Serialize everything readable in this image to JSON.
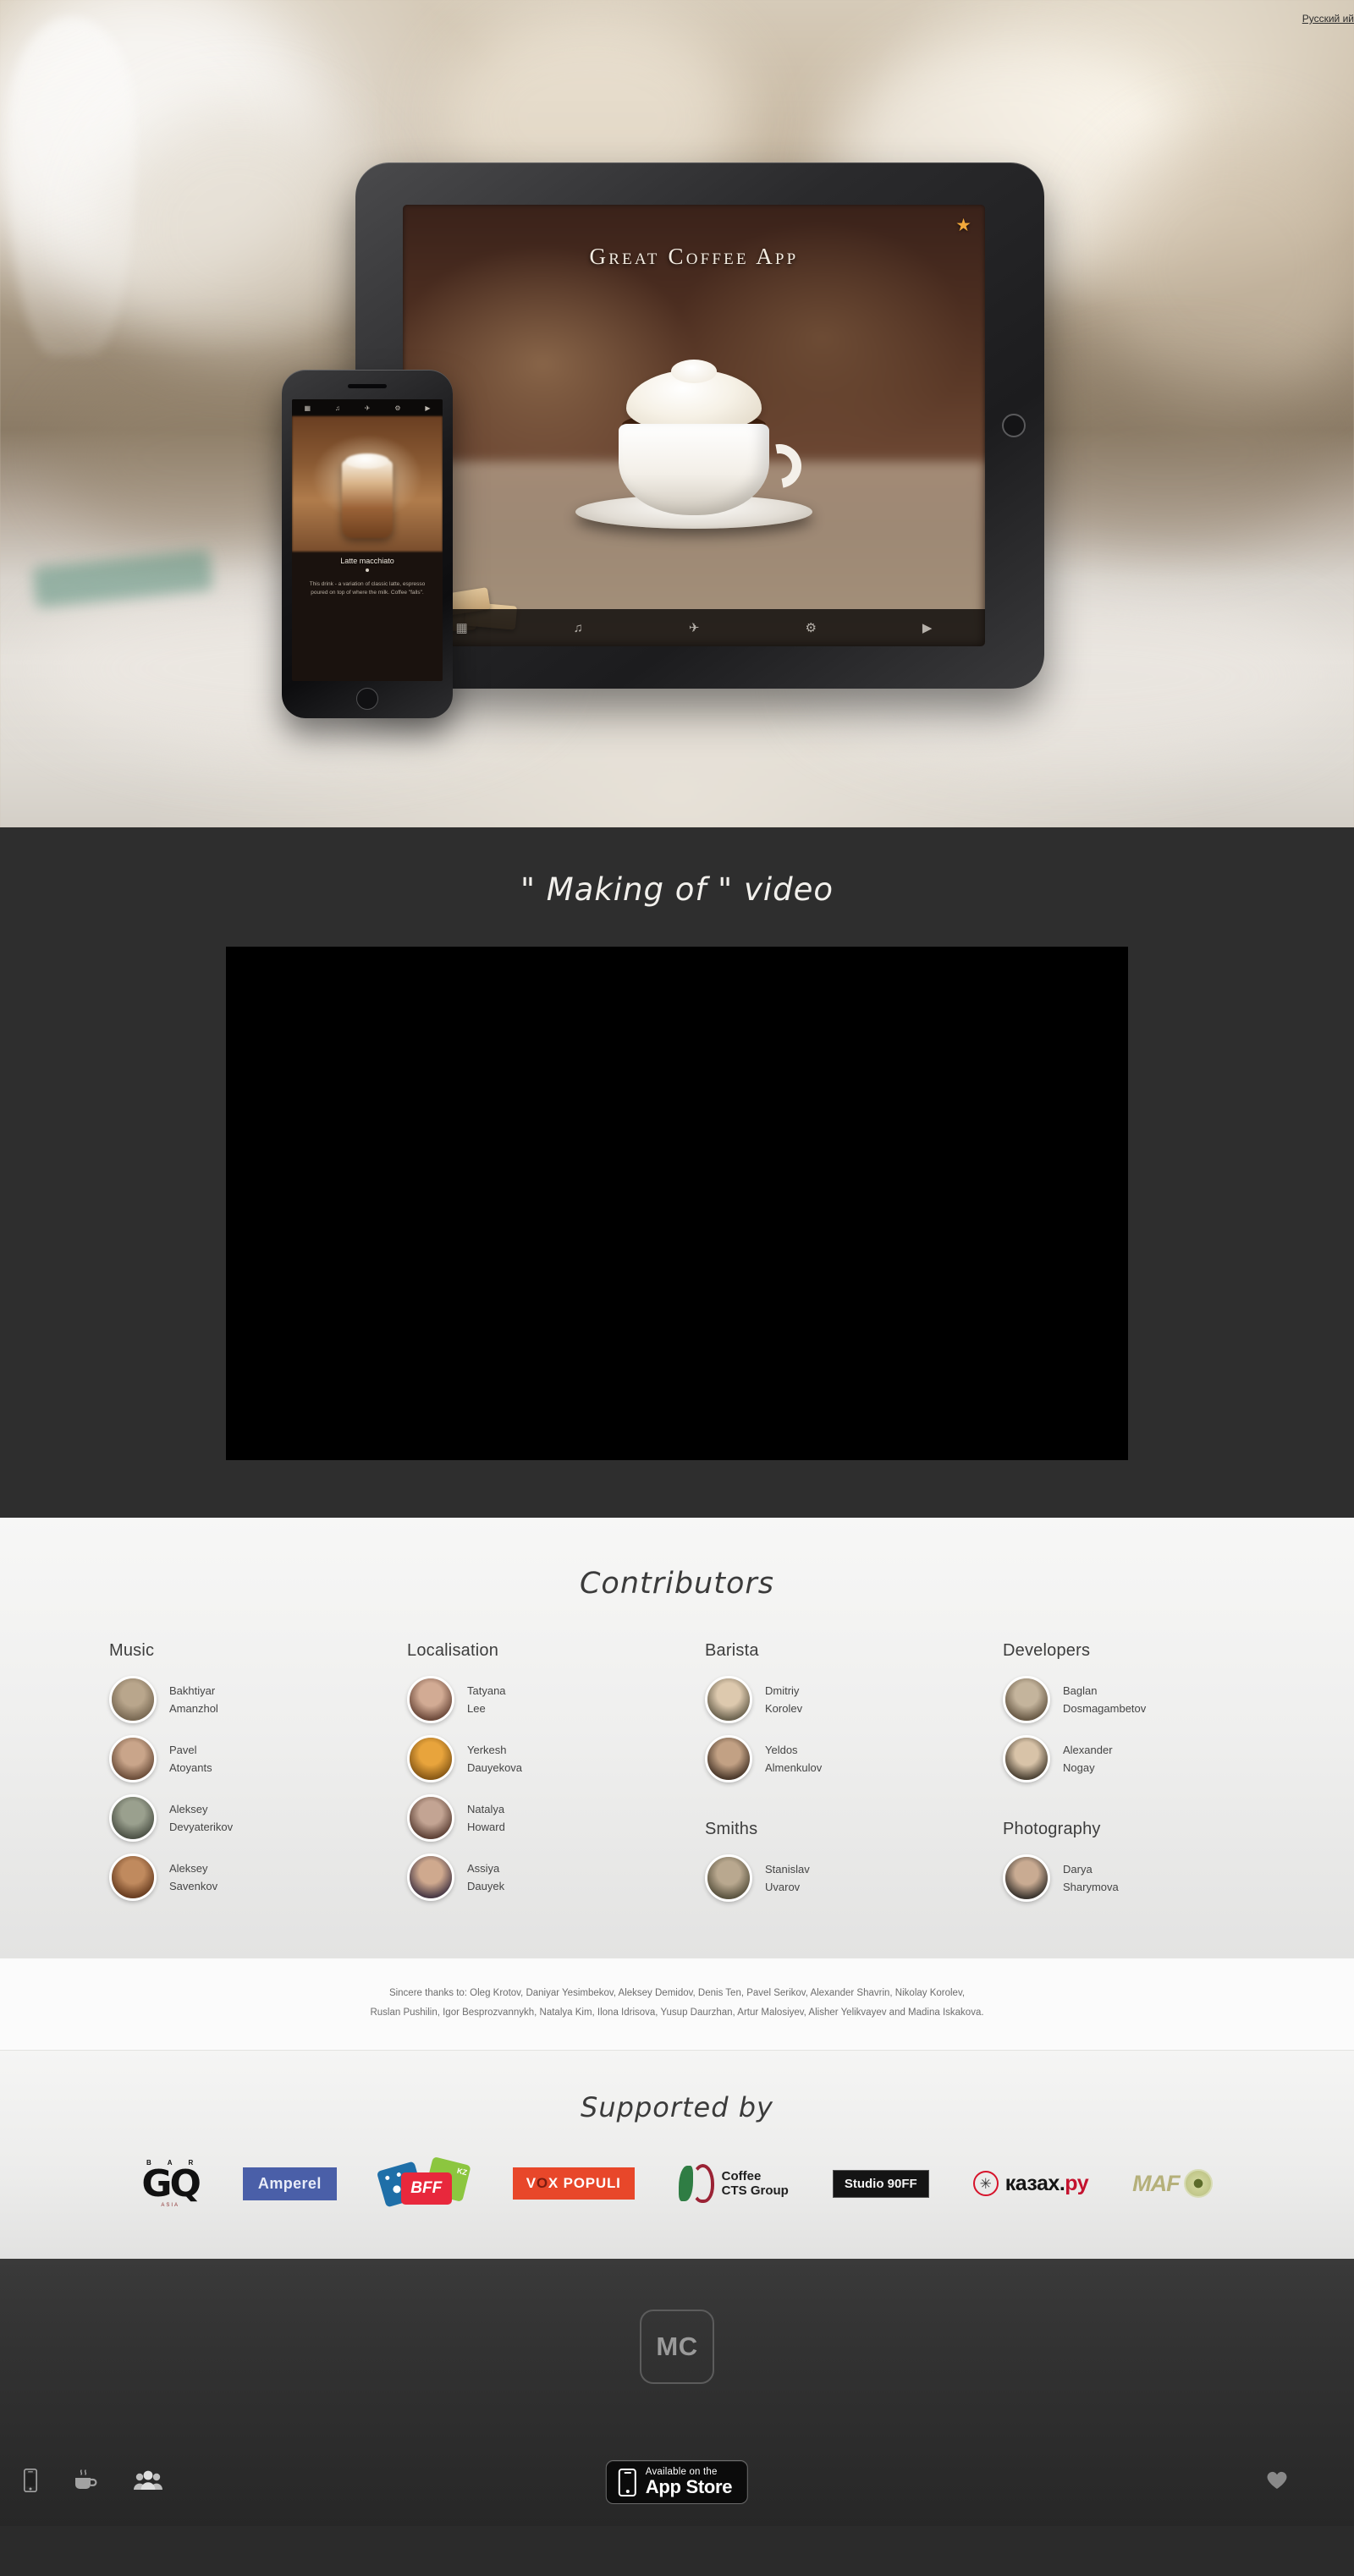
{
  "hero": {
    "language_link": "Русский ий",
    "ipad": {
      "app_title": "Great Coffee App",
      "star_icon": "star-icon",
      "toolbar": [
        "▦",
        "♫",
        "✈",
        "⚙",
        "▶"
      ]
    },
    "iphone": {
      "topbar": [
        "▦",
        "♫",
        "✈",
        "⚙",
        "▶"
      ],
      "drink_name": "Latte macchiato",
      "drink_desc": "This drink - a variation of classic latte, espresso poured on top of where the milk. Coffee \"falls\"."
    }
  },
  "video": {
    "heading": "\" Making of \" video"
  },
  "contributors": {
    "heading": "Contributors",
    "columns": [
      {
        "groups": [
          {
            "title": "Music",
            "people": [
              {
                "first": "Bakhtiyar",
                "last": "Amanzhol",
                "color1": "#b9a68c",
                "color2": "#7a6a54"
              },
              {
                "first": "Pavel",
                "last": "Atoyants",
                "color1": "#c9a58a",
                "color2": "#6d4f3b"
              },
              {
                "first": "Aleksey",
                "last": "Devyaterikov",
                "color1": "#9aa08e",
                "color2": "#4f5448"
              },
              {
                "first": "Aleksey",
                "last": "Savenkov",
                "color1": "#c08a5e",
                "color2": "#6b3f22"
              }
            ]
          }
        ]
      },
      {
        "groups": [
          {
            "title": "Localisation",
            "people": [
              {
                "first": "Tatyana",
                "last": "Lee",
                "color1": "#d2ab94",
                "color2": "#6e4b3c"
              },
              {
                "first": "Yerkesh",
                "last": "Dauyekova",
                "color1": "#e8a43c",
                "color2": "#8a5a16"
              },
              {
                "first": "Natalya",
                "last": "Howard",
                "color1": "#c3a493",
                "color2": "#5f4338"
              },
              {
                "first": "Assiya",
                "last": "Dauyek",
                "color1": "#cfa98e",
                "color2": "#4a3a46"
              }
            ]
          }
        ]
      },
      {
        "groups": [
          {
            "title": "Barista",
            "people": [
              {
                "first": "Dmitriy",
                "last": "Korolev",
                "color1": "#ddc9ae",
                "color2": "#6d6450"
              },
              {
                "first": "Yeldos",
                "last": "Almenkulov",
                "color1": "#c2a184",
                "color2": "#4c3a2c"
              }
            ]
          },
          {
            "title": "Smiths",
            "people": [
              {
                "first": "Stanislav",
                "last": "Uvarov",
                "color1": "#b9a88f",
                "color2": "#5c5541"
              }
            ]
          }
        ]
      },
      {
        "groups": [
          {
            "title": "Developers",
            "people": [
              {
                "first": "Baglan",
                "last": "Dosmagambetov",
                "color1": "#c4b49c",
                "color2": "#6a5b47"
              },
              {
                "first": "Alexander",
                "last": "Nogay",
                "color1": "#d8c3a8",
                "color2": "#4e4436"
              }
            ]
          },
          {
            "title": "Photography",
            "people": [
              {
                "first": "Darya",
                "last": "Sharymova",
                "color1": "#c9ab92",
                "color2": "#3c3630"
              }
            ]
          }
        ]
      }
    ]
  },
  "thanks": {
    "line1": "Sincere thanks to: Oleg Krotov, Daniyar Yesimbekov, Aleksey Demidov, Denis Ten, Pavel Serikov, Alexander Shavrin, Nikolay Korolev,",
    "line2": "Ruslan Pushilin, Igor Besprozvannykh, Natalya Kim, Ilona Idrisova, Yusup Daurzhan, Artur Malosiyev, Alisher Yelikvayev and Madina Iskakova."
  },
  "supported": {
    "heading": "Supported by",
    "logos": {
      "gq_bar": [
        "B",
        "A",
        "R"
      ],
      "gq_main": "GQ",
      "gq_sub": "ASIA",
      "amperel": "Amperel",
      "bff": "BFF",
      "bff_kz": "KZ",
      "vox_v": "V",
      "vox_o": "O",
      "vox_rest": "X POPULI",
      "cts_line1": "Coffee",
      "cts_line2": "CTS Group",
      "studio": "Studio 90FF",
      "kazah_text": "казах.",
      "kazah_ru": "ру",
      "maf": "MAF"
    }
  },
  "footer": {
    "logo": "MC",
    "left_icons": [
      "phone-icon",
      "coffee-cup-icon",
      "people-icon"
    ],
    "right_icon": "heart-icon",
    "appstore": {
      "small": "Available on the",
      "big": "App Store"
    }
  }
}
